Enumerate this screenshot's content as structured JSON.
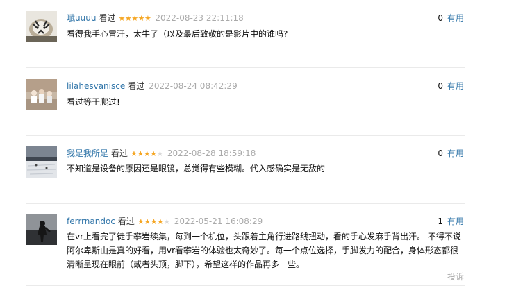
{
  "comments": [
    {
      "user": "珷uuuu",
      "watched_label": "看过",
      "rating": 5,
      "time": "2022-08-23 22:11:18",
      "votes": "0",
      "useful_label": "有用",
      "text": "看得我手心冒汗，太牛了（以及最后致敬的是影片中的谁吗?"
    },
    {
      "user": "lilahesvanisce",
      "watched_label": "看过",
      "rating": 0,
      "time": "2022-08-24 08:42:29",
      "votes": "0",
      "useful_label": "有用",
      "text": "看过等于爬过!"
    },
    {
      "user": "我是我所是",
      "watched_label": "看过",
      "rating": 4,
      "time": "2022-08-28 18:59:18",
      "votes": "0",
      "useful_label": "有用",
      "text": "不知道是设备的原因还是眼镜，总觉得有些模糊。代入感确实是无敌的"
    },
    {
      "user": "ferrrnandoc",
      "watched_label": "看过",
      "rating": 4,
      "time": "2022-05-21 16:08:29",
      "votes": "1",
      "useful_label": "有用",
      "text": "在vr上看完了徒手攀岩续集，每到一个机位，头跟着主角行进路线扭动，看的手心发麻手背出汗。 不得不说阿尔卑斯山是真的好看，用vr看攀岩的体验也太奇妙了。每一个点位选择，手脚发力的配合，身体形态都很清晰呈现在眼前（或者头顶，脚下），希望这样的作品再多一些。",
      "report_label": "投诉"
    }
  ],
  "colors": {
    "link": "#3377aa",
    "star_on": "#f5a623",
    "star_off": "#d9d9d9",
    "meta_gray": "#aaaaaa"
  },
  "icons": [
    "avatar-tiger",
    "avatar-people",
    "avatar-snow-field",
    "avatar-silhouette",
    "star-icon"
  ]
}
